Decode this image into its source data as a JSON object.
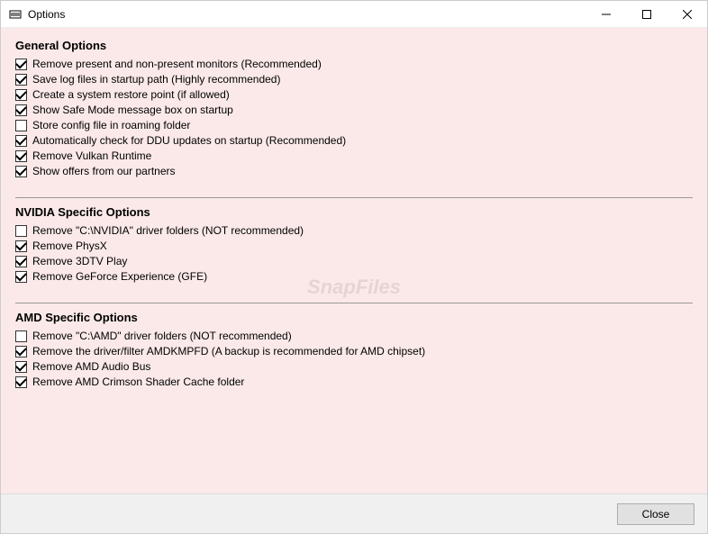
{
  "window": {
    "title": "Options"
  },
  "sections": {
    "general": {
      "title": "General Options",
      "options": [
        {
          "label": "Remove present and non-present monitors (Recommended)",
          "checked": true
        },
        {
          "label": "Save log files in startup path (Highly recommended)",
          "checked": true
        },
        {
          "label": "Create a system restore point (if allowed)",
          "checked": true
        },
        {
          "label": "Show Safe Mode message box on startup",
          "checked": true
        },
        {
          "label": "Store config file in roaming folder",
          "checked": false
        },
        {
          "label": "Automatically check for DDU updates on startup (Recommended)",
          "checked": true
        },
        {
          "label": "Remove Vulkan Runtime",
          "checked": true
        },
        {
          "label": "Show offers from our partners",
          "checked": true
        }
      ]
    },
    "nvidia": {
      "title": "NVIDIA Specific Options",
      "options": [
        {
          "label": "Remove \"C:\\NVIDIA\" driver folders (NOT recommended)",
          "checked": false
        },
        {
          "label": "Remove PhysX",
          "checked": true
        },
        {
          "label": "Remove 3DTV Play",
          "checked": true
        },
        {
          "label": "Remove GeForce Experience (GFE)",
          "checked": true
        }
      ]
    },
    "amd": {
      "title": "AMD Specific Options",
      "options": [
        {
          "label": "Remove \"C:\\AMD\" driver folders (NOT recommended)",
          "checked": false
        },
        {
          "label": "Remove the driver/filter AMDKMPFD (A backup is recommended for AMD chipset)",
          "checked": true
        },
        {
          "label": "Remove AMD Audio Bus",
          "checked": true
        },
        {
          "label": "Remove AMD Crimson Shader Cache folder",
          "checked": true
        }
      ]
    }
  },
  "footer": {
    "close_label": "Close"
  },
  "watermark": "SnapFiles"
}
